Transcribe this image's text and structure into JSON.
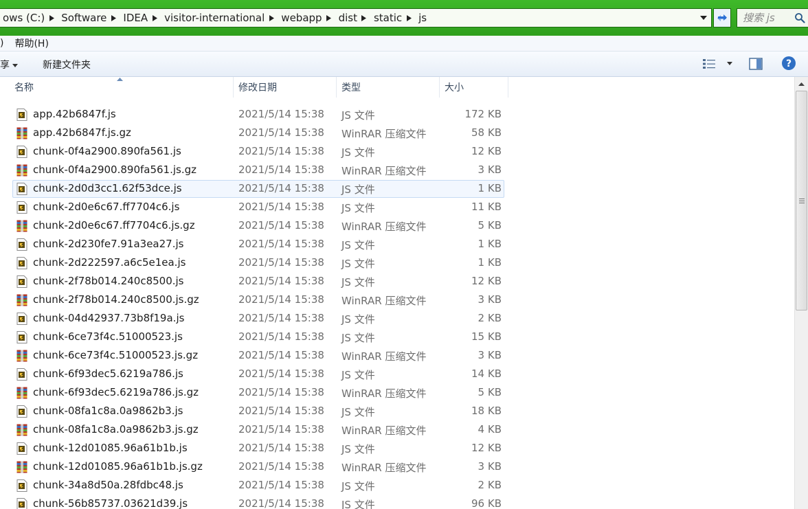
{
  "address_bar": {
    "crumbs": [
      "ows (C:)",
      "Software",
      "IDEA",
      "visitor-international",
      "webapp",
      "dist",
      "static",
      "js"
    ],
    "search_placeholder": "搜索 js"
  },
  "menu": {
    "items": [
      ")",
      "帮助(H)"
    ]
  },
  "toolbar": {
    "share_label": "享",
    "new_folder_label": "新建文件夹"
  },
  "columns": {
    "name": "名称",
    "date": "修改日期",
    "type": "类型",
    "size": "大小"
  },
  "files": [
    {
      "name": "app.42b6847f.js",
      "date": "2021/5/14 15:38",
      "type": "JS 文件",
      "size": "172 KB",
      "icon": "js-file-icon"
    },
    {
      "name": "app.42b6847f.js.gz",
      "date": "2021/5/14 15:38",
      "type": "WinRAR 压缩文件",
      "size": "58 KB",
      "icon": "winrar-archive-icon"
    },
    {
      "name": "chunk-0f4a2900.890fa561.js",
      "date": "2021/5/14 15:38",
      "type": "JS 文件",
      "size": "12 KB",
      "icon": "js-file-icon"
    },
    {
      "name": "chunk-0f4a2900.890fa561.js.gz",
      "date": "2021/5/14 15:38",
      "type": "WinRAR 压缩文件",
      "size": "3 KB",
      "icon": "winrar-archive-icon"
    },
    {
      "name": "chunk-2d0d3cc1.62f53dce.js",
      "date": "2021/5/14 15:38",
      "type": "JS 文件",
      "size": "1 KB",
      "icon": "js-file-icon",
      "hover": true
    },
    {
      "name": "chunk-2d0e6c67.ff7704c6.js",
      "date": "2021/5/14 15:38",
      "type": "JS 文件",
      "size": "11 KB",
      "icon": "js-file-icon"
    },
    {
      "name": "chunk-2d0e6c67.ff7704c6.js.gz",
      "date": "2021/5/14 15:38",
      "type": "WinRAR 压缩文件",
      "size": "5 KB",
      "icon": "winrar-archive-icon"
    },
    {
      "name": "chunk-2d230fe7.91a3ea27.js",
      "date": "2021/5/14 15:38",
      "type": "JS 文件",
      "size": "1 KB",
      "icon": "js-file-icon"
    },
    {
      "name": "chunk-2d222597.a6c5e1ea.js",
      "date": "2021/5/14 15:38",
      "type": "JS 文件",
      "size": "1 KB",
      "icon": "js-file-icon"
    },
    {
      "name": "chunk-2f78b014.240c8500.js",
      "date": "2021/5/14 15:38",
      "type": "JS 文件",
      "size": "12 KB",
      "icon": "js-file-icon"
    },
    {
      "name": "chunk-2f78b014.240c8500.js.gz",
      "date": "2021/5/14 15:38",
      "type": "WinRAR 压缩文件",
      "size": "3 KB",
      "icon": "winrar-archive-icon"
    },
    {
      "name": "chunk-04d42937.73b8f19a.js",
      "date": "2021/5/14 15:38",
      "type": "JS 文件",
      "size": "2 KB",
      "icon": "js-file-icon"
    },
    {
      "name": "chunk-6ce73f4c.51000523.js",
      "date": "2021/5/14 15:38",
      "type": "JS 文件",
      "size": "15 KB",
      "icon": "js-file-icon"
    },
    {
      "name": "chunk-6ce73f4c.51000523.js.gz",
      "date": "2021/5/14 15:38",
      "type": "WinRAR 压缩文件",
      "size": "3 KB",
      "icon": "winrar-archive-icon"
    },
    {
      "name": "chunk-6f93dec5.6219a786.js",
      "date": "2021/5/14 15:38",
      "type": "JS 文件",
      "size": "14 KB",
      "icon": "js-file-icon"
    },
    {
      "name": "chunk-6f93dec5.6219a786.js.gz",
      "date": "2021/5/14 15:38",
      "type": "WinRAR 压缩文件",
      "size": "5 KB",
      "icon": "winrar-archive-icon"
    },
    {
      "name": "chunk-08fa1c8a.0a9862b3.js",
      "date": "2021/5/14 15:38",
      "type": "JS 文件",
      "size": "18 KB",
      "icon": "js-file-icon"
    },
    {
      "name": "chunk-08fa1c8a.0a9862b3.js.gz",
      "date": "2021/5/14 15:38",
      "type": "WinRAR 压缩文件",
      "size": "4 KB",
      "icon": "winrar-archive-icon"
    },
    {
      "name": "chunk-12d01085.96a61b1b.js",
      "date": "2021/5/14 15:38",
      "type": "JS 文件",
      "size": "12 KB",
      "icon": "js-file-icon"
    },
    {
      "name": "chunk-12d01085.96a61b1b.js.gz",
      "date": "2021/5/14 15:38",
      "type": "WinRAR 压缩文件",
      "size": "3 KB",
      "icon": "winrar-archive-icon"
    },
    {
      "name": "chunk-34a8d50a.28fdbc48.js",
      "date": "2021/5/14 15:38",
      "type": "JS 文件",
      "size": "2 KB",
      "icon": "js-file-icon"
    },
    {
      "name": "chunk-56b85737.03621d39.js",
      "date": "2021/5/14 15:38",
      "type": "JS 文件",
      "size": "96 KB",
      "icon": "js-file-icon"
    }
  ],
  "colors": {
    "title_green": "#3fb92a",
    "hover_border": "#c5daf3",
    "hover_fill": "#f2f7fe",
    "secondary_text": "#6e6e6e"
  }
}
